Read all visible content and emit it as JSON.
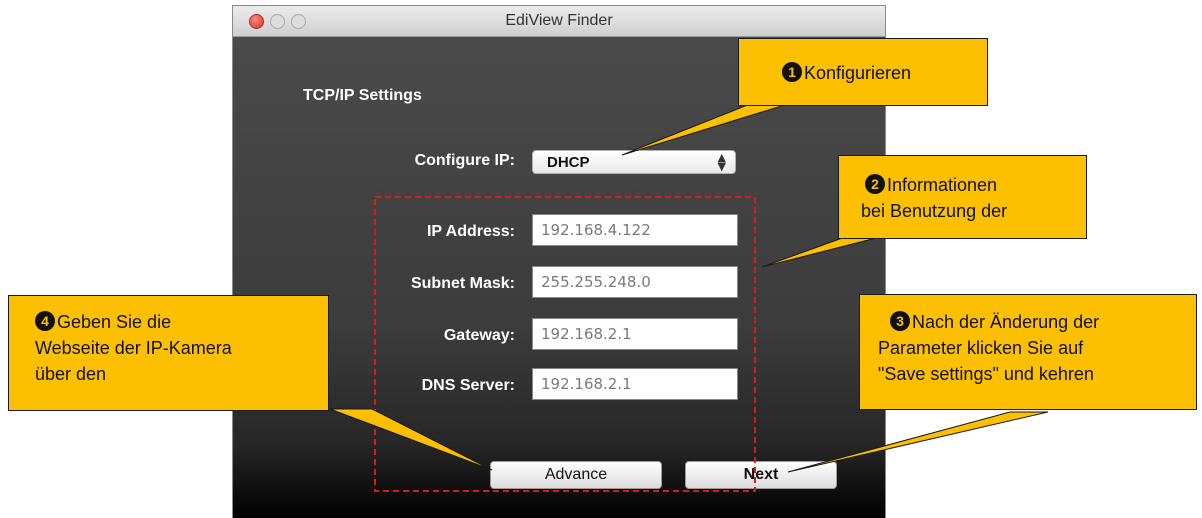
{
  "window": {
    "title": "EdiView Finder",
    "section_title": "TCP/IP Settings",
    "configure_ip": {
      "label": "Configure IP:",
      "selected": "DHCP",
      "arrows": "▲▼"
    },
    "fields": [
      {
        "label": "IP Address:",
        "value": "192.168.4.122"
      },
      {
        "label": "Subnet Mask:",
        "value": "255.255.248.0"
      },
      {
        "label": "Gateway:",
        "value": "192.168.2.1"
      },
      {
        "label": "DNS Server:",
        "value": "192.168.2.1"
      }
    ],
    "buttons": {
      "advance": "Advance",
      "next": "Next"
    }
  },
  "callouts": {
    "c1": {
      "number": "1",
      "lines": [
        "Konfigurieren"
      ]
    },
    "c2": {
      "number": "2",
      "lines": [
        "Informationen",
        "bei Benutzung der"
      ]
    },
    "c3": {
      "number": "3",
      "lines": [
        "Nach der Änderung der",
        "Parameter klicken Sie auf",
        "\"Save settings\" und kehren"
      ]
    },
    "c4": {
      "number": "4",
      "lines": [
        "Geben Sie die",
        "Webseite der IP-Kamera",
        "über den"
      ]
    }
  },
  "colors": {
    "callout_fill": "#fcc000",
    "dashed_border": "#d81c1c",
    "window_bg": "#3c3c3c"
  }
}
